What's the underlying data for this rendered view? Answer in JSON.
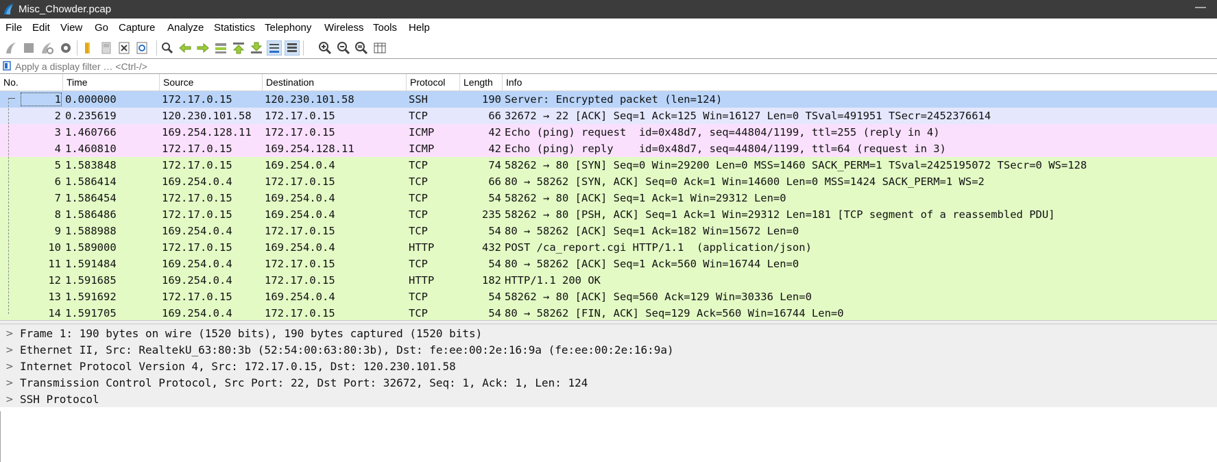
{
  "window": {
    "title": "Misc_Chowder.pcap",
    "minimize_glyph": "—"
  },
  "menu": [
    "File",
    "Edit",
    "View",
    "Go",
    "Capture",
    "Analyze",
    "Statistics",
    "Telephony",
    "Wireless",
    "Tools",
    "Help"
  ],
  "toolbar_icons": [
    "start-capture-icon",
    "stop-capture-icon",
    "restart-capture-icon",
    "capture-options-icon",
    "open-file-icon",
    "save-file-icon",
    "close-file-icon",
    "reload-file-icon",
    "find-packet-icon",
    "go-back-icon",
    "go-forward-icon",
    "go-to-packet-icon",
    "go-first-packet-icon",
    "go-last-packet-icon",
    "auto-scroll-icon",
    "colorize-icon",
    "zoom-in-icon",
    "zoom-out-icon",
    "normal-size-icon",
    "resize-columns-icon"
  ],
  "filter": {
    "placeholder": "Apply a display filter … <Ctrl-/>"
  },
  "columns": {
    "no": "No.",
    "time": "Time",
    "source": "Source",
    "destination": "Destination",
    "protocol": "Protocol",
    "length": "Length",
    "info": "Info"
  },
  "colors": {
    "selected": "#b9d4f8",
    "tcp_ack": "#e5e7fd",
    "icmp": "#fae0fd",
    "http_tcp": "#e3fac5"
  },
  "packets": [
    {
      "no": "1",
      "time": "0.000000",
      "source": "172.17.0.15",
      "destination": "120.230.101.58",
      "protocol": "SSH",
      "length": "190",
      "info": "Server: Encrypted packet (len=124)",
      "color": "#b9d4f8"
    },
    {
      "no": "2",
      "time": "0.235619",
      "source": "120.230.101.58",
      "destination": "172.17.0.15",
      "protocol": "TCP",
      "length": "66",
      "info": "32672 → 22 [ACK] Seq=1 Ack=125 Win=16127 Len=0 TSval=491951 TSecr=2452376614",
      "color": "#e5e7fd"
    },
    {
      "no": "3",
      "time": "1.460766",
      "source": "169.254.128.11",
      "destination": "172.17.0.15",
      "protocol": "ICMP",
      "length": "42",
      "info": "Echo (ping) request  id=0x48d7, seq=44804/1199, ttl=255 (reply in 4)",
      "color": "#fae0fd"
    },
    {
      "no": "4",
      "time": "1.460810",
      "source": "172.17.0.15",
      "destination": "169.254.128.11",
      "protocol": "ICMP",
      "length": "42",
      "info": "Echo (ping) reply    id=0x48d7, seq=44804/1199, ttl=64 (request in 3)",
      "color": "#fae0fd"
    },
    {
      "no": "5",
      "time": "1.583848",
      "source": "172.17.0.15",
      "destination": "169.254.0.4",
      "protocol": "TCP",
      "length": "74",
      "info": "58262 → 80 [SYN] Seq=0 Win=29200 Len=0 MSS=1460 SACK_PERM=1 TSval=2425195072 TSecr=0 WS=128",
      "color": "#e3fac5"
    },
    {
      "no": "6",
      "time": "1.586414",
      "source": "169.254.0.4",
      "destination": "172.17.0.15",
      "protocol": "TCP",
      "length": "66",
      "info": "80 → 58262 [SYN, ACK] Seq=0 Ack=1 Win=14600 Len=0 MSS=1424 SACK_PERM=1 WS=2",
      "color": "#e3fac5"
    },
    {
      "no": "7",
      "time": "1.586454",
      "source": "172.17.0.15",
      "destination": "169.254.0.4",
      "protocol": "TCP",
      "length": "54",
      "info": "58262 → 80 [ACK] Seq=1 Ack=1 Win=29312 Len=0",
      "color": "#e3fac5"
    },
    {
      "no": "8",
      "time": "1.586486",
      "source": "172.17.0.15",
      "destination": "169.254.0.4",
      "protocol": "TCP",
      "length": "235",
      "info": "58262 → 80 [PSH, ACK] Seq=1 Ack=1 Win=29312 Len=181 [TCP segment of a reassembled PDU]",
      "color": "#e3fac5"
    },
    {
      "no": "9",
      "time": "1.588988",
      "source": "169.254.0.4",
      "destination": "172.17.0.15",
      "protocol": "TCP",
      "length": "54",
      "info": "80 → 58262 [ACK] Seq=1 Ack=182 Win=15672 Len=0",
      "color": "#e3fac5"
    },
    {
      "no": "10",
      "time": "1.589000",
      "source": "172.17.0.15",
      "destination": "169.254.0.4",
      "protocol": "HTTP",
      "length": "432",
      "info": "POST /ca_report.cgi HTTP/1.1  (application/json)",
      "color": "#e3fac5"
    },
    {
      "no": "11",
      "time": "1.591484",
      "source": "169.254.0.4",
      "destination": "172.17.0.15",
      "protocol": "TCP",
      "length": "54",
      "info": "80 → 58262 [ACK] Seq=1 Ack=560 Win=16744 Len=0",
      "color": "#e3fac5"
    },
    {
      "no": "12",
      "time": "1.591685",
      "source": "169.254.0.4",
      "destination": "172.17.0.15",
      "protocol": "HTTP",
      "length": "182",
      "info": "HTTP/1.1 200 OK",
      "color": "#e3fac5"
    },
    {
      "no": "13",
      "time": "1.591692",
      "source": "172.17.0.15",
      "destination": "169.254.0.4",
      "protocol": "TCP",
      "length": "54",
      "info": "58262 → 80 [ACK] Seq=560 Ack=129 Win=30336 Len=0",
      "color": "#e3fac5"
    },
    {
      "no": "14",
      "time": "1.591705",
      "source": "169.254.0.4",
      "destination": "172.17.0.15",
      "protocol": "TCP",
      "length": "54",
      "info": "80 → 58262 [FIN, ACK] Seq=129 Ack=560 Win=16744 Len=0",
      "color": "#e3fac5"
    }
  ],
  "details": [
    {
      "chevron": ">",
      "text": "Frame 1: 190 bytes on wire (1520 bits), 190 bytes captured (1520 bits)"
    },
    {
      "chevron": ">",
      "text": "Ethernet II, Src: RealtekU_63:80:3b (52:54:00:63:80:3b), Dst: fe:ee:00:2e:16:9a (fe:ee:00:2e:16:9a)"
    },
    {
      "chevron": ">",
      "text": "Internet Protocol Version 4, Src: 172.17.0.15, Dst: 120.230.101.58"
    },
    {
      "chevron": ">",
      "text": "Transmission Control Protocol, Src Port: 22, Dst Port: 32672, Seq: 1, Ack: 1, Len: 124"
    },
    {
      "chevron": ">",
      "text": "SSH Protocol"
    }
  ]
}
